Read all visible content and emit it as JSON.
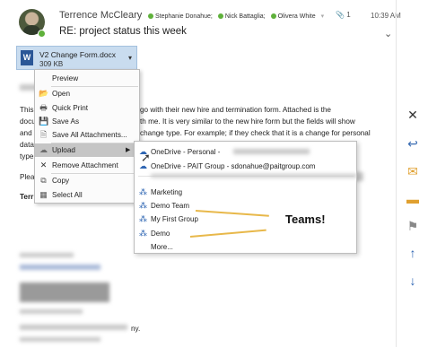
{
  "header": {
    "sender": "Terrence McCleary",
    "recipients": [
      "Stephanie Donahue;",
      "Nick Battaglia;",
      "Olivera White"
    ],
    "recipient_more_arrow": "▾",
    "attachment_count": "1",
    "time": "10:39 AM",
    "subject": "RE: project status this week",
    "presence_color": "#5fb13b"
  },
  "attachment": {
    "name": "V2 Change Form.docx",
    "size": "309 KB",
    "icon": "word-icon",
    "icon_letter": "W"
  },
  "body": {
    "lines": [
      "This",
      "docu",
      "and",
      "data",
      "type"
    ],
    "line1_right": "go with their new hire and termination form.  Attached is the",
    "line2_right": "th me.  It is very similar to the new hire form but the fields will show",
    "line3_right": "change type.  For example; if they check that it is a change for personal",
    "greeting": "Plea",
    "signature": "Terr",
    "footer_fragment": "ny."
  },
  "context_menu": {
    "items": [
      {
        "label": "Preview",
        "icon": "preview-icon",
        "glyph": ""
      },
      {
        "label": "Open",
        "icon": "open-folder-icon",
        "glyph": "📂"
      },
      {
        "label": "Quick Print",
        "icon": "print-icon",
        "glyph": "🖶"
      },
      {
        "label": "Save As",
        "icon": "save-icon",
        "glyph": "💾"
      },
      {
        "label": "Save All Attachments...",
        "icon": "save-all-icon",
        "glyph": "🗎"
      },
      {
        "label": "Upload",
        "icon": "upload-icon",
        "glyph": "☁",
        "highlighted": true,
        "has_submenu": true
      },
      {
        "label": "Remove Attachment",
        "icon": "remove-icon",
        "glyph": "✕"
      },
      {
        "label": "Copy",
        "icon": "copy-icon",
        "glyph": "⧉"
      },
      {
        "label": "Select All",
        "icon": "select-all-icon",
        "glyph": "▦"
      }
    ]
  },
  "upload_submenu": {
    "items": [
      {
        "label": "OneDrive - Personal -",
        "icon": "onedrive-icon"
      },
      {
        "label": "OneDrive - PAIT Group - sdonahue@paitgroup.com",
        "icon": "onedrive-icon"
      },
      {
        "label": "Marketing",
        "icon": "group-icon"
      },
      {
        "label": "Demo Team",
        "icon": "group-icon"
      },
      {
        "label": "My First Group",
        "icon": "group-icon"
      },
      {
        "label": "Demo",
        "icon": "group-icon"
      },
      {
        "label": "More...",
        "icon": ""
      }
    ]
  },
  "annotation": {
    "text": "Teams!",
    "color": "#e8b84a"
  },
  "right_panel": {
    "icons": [
      "close-icon",
      "reply-icon",
      "envelope-icon",
      "move-to-folder-icon",
      "flag-icon",
      "up-arrow-icon",
      "down-arrow-icon"
    ]
  },
  "colors": {
    "attachment_bg": "#c9dcef",
    "menu_highlight": "#c5c5c5",
    "accent_blue": "#2f66b3"
  }
}
